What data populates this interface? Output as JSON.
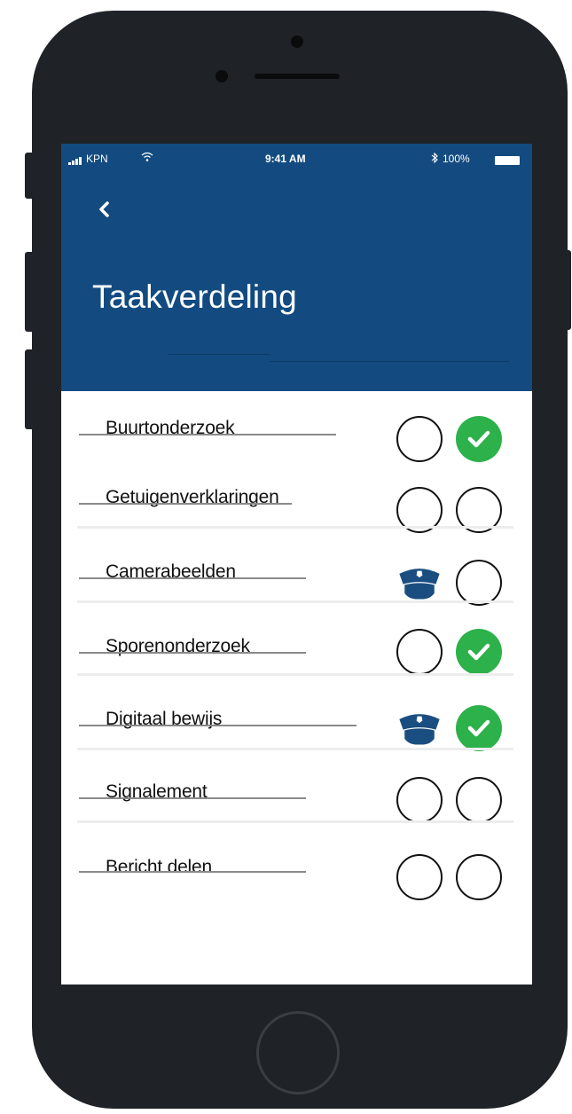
{
  "status_bar": {
    "carrier": "KPN",
    "time": "9:41 AM",
    "battery": "100%"
  },
  "header": {
    "back_icon": "chevron-left-icon",
    "title": "Taakverdeling"
  },
  "colors": {
    "header_bg": "#134b80",
    "check": "#2db14a",
    "police_cap": "#1a4e80"
  },
  "tasks": [
    {
      "label": "Buurtonderzoek",
      "slot1": "empty",
      "slot2": "checked"
    },
    {
      "label": "Getuigenverklaringen",
      "slot1": "empty",
      "slot2": "empty"
    },
    {
      "label": "Camerabeelden",
      "slot1": "police-cap",
      "slot2": "empty"
    },
    {
      "label": "Sporenonderzoek",
      "slot1": "empty",
      "slot2": "checked"
    },
    {
      "label": "Digitaal bewijs",
      "slot1": "police-cap",
      "slot2": "checked"
    },
    {
      "label": "Signalement",
      "slot1": "empty",
      "slot2": "empty"
    },
    {
      "label": "Bericht delen",
      "slot1": "empty",
      "slot2": "empty"
    }
  ]
}
